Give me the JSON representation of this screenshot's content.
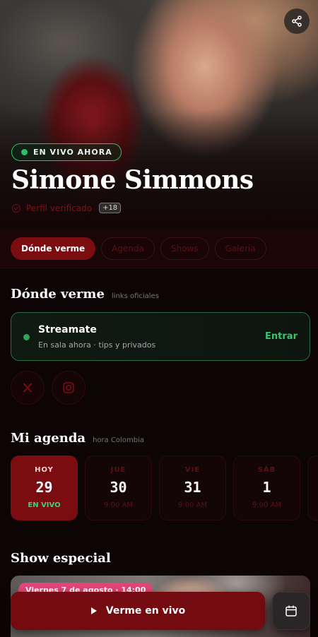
{
  "hero": {
    "live_label": "EN VIVO AHORA",
    "name": "Simone Simmons",
    "verified_label": "Perfil verificado",
    "age_badge": "+18"
  },
  "tabs": [
    {
      "label": "Dónde verme",
      "active": true
    },
    {
      "label": "Agenda",
      "active": false
    },
    {
      "label": "Shows",
      "active": false
    },
    {
      "label": "Galería",
      "active": false
    }
  ],
  "where": {
    "title": "Dónde verme",
    "subtitle": "links oficiales",
    "platform": {
      "name": "Streamate",
      "description": "En sala ahora · tips y privados",
      "action": "Entrar"
    },
    "socials": [
      "x-icon",
      "instagram-icon"
    ]
  },
  "agenda": {
    "title": "Mi agenda",
    "subtitle": "hora Colombia",
    "days": [
      {
        "name": "HOY",
        "number": "29",
        "time": "EN VIVO"
      },
      {
        "name": "JUE",
        "number": "30",
        "time": "9:00 AM"
      },
      {
        "name": "VIE",
        "number": "31",
        "time": "9:00 AM"
      },
      {
        "name": "SÁB",
        "number": "1",
        "time": "9:00 AM"
      }
    ]
  },
  "special": {
    "title": "Show especial",
    "date": "Viernes 7 de agosto · 14:00"
  },
  "cta": {
    "label": "Verme en vivo"
  },
  "colors": {
    "accent": "#7b0d11",
    "live": "#2fbf62",
    "background": "#0d0405"
  }
}
